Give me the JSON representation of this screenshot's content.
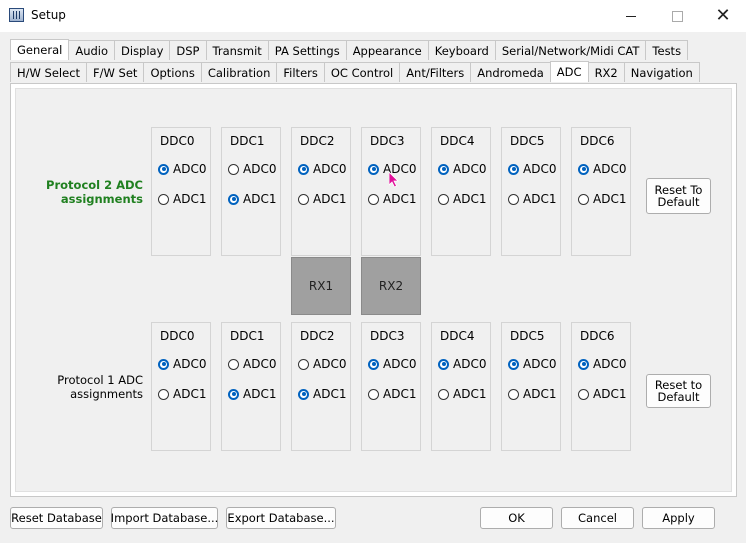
{
  "window": {
    "title": "Setup"
  },
  "tabs_main": [
    "General",
    "Audio",
    "Display",
    "DSP",
    "Transmit",
    "PA Settings",
    "Appearance",
    "Keyboard",
    "Serial/Network/Midi CAT",
    "Tests"
  ],
  "tabs_sub": [
    "H/W Select",
    "F/W Set",
    "Options",
    "Calibration",
    "Filters",
    "OC Control",
    "Ant/Filters",
    "Andromeda",
    "ADC",
    "RX2",
    "Navigation"
  ],
  "active_main_tab": "General",
  "active_sub_tab": "ADC",
  "option_labels": {
    "adc0": "ADC0",
    "adc1": "ADC1"
  },
  "protocol2": {
    "label_line1": "Protocol 2 ADC",
    "label_line2": "assignments",
    "reset_line1": "Reset To",
    "reset_line2": "Default",
    "ddcs": [
      {
        "name": "DDC0",
        "selected": "ADC0"
      },
      {
        "name": "DDC1",
        "selected": "ADC1"
      },
      {
        "name": "DDC2",
        "selected": "ADC0"
      },
      {
        "name": "DDC3",
        "selected": "ADC0"
      },
      {
        "name": "DDC4",
        "selected": "ADC0"
      },
      {
        "name": "DDC5",
        "selected": "ADC0"
      },
      {
        "name": "DDC6",
        "selected": "ADC0"
      }
    ]
  },
  "rx_labels": [
    "RX1",
    "RX2"
  ],
  "protocol1": {
    "label_line1": "Protocol 1 ADC",
    "label_line2": "assignments",
    "reset_line1": "Reset to",
    "reset_line2": "Default",
    "ddcs": [
      {
        "name": "DDC0",
        "selected": "ADC0"
      },
      {
        "name": "DDC1",
        "selected": "ADC1"
      },
      {
        "name": "DDC2",
        "selected": "ADC1"
      },
      {
        "name": "DDC3",
        "selected": "ADC0"
      },
      {
        "name": "DDC4",
        "selected": "ADC0"
      },
      {
        "name": "DDC5",
        "selected": "ADC0"
      },
      {
        "name": "DDC6",
        "selected": "ADC0"
      }
    ]
  },
  "footer": {
    "reset_database": "Reset Database",
    "import_database": "Import Database...",
    "export_database": "Export Database...",
    "ok": "OK",
    "cancel": "Cancel",
    "apply": "Apply"
  },
  "colors": {
    "protocol2_label": "#208020",
    "radio_checked": "#0062bf",
    "rx_block": "#a0a0a0",
    "cursor": "#e0109a"
  }
}
